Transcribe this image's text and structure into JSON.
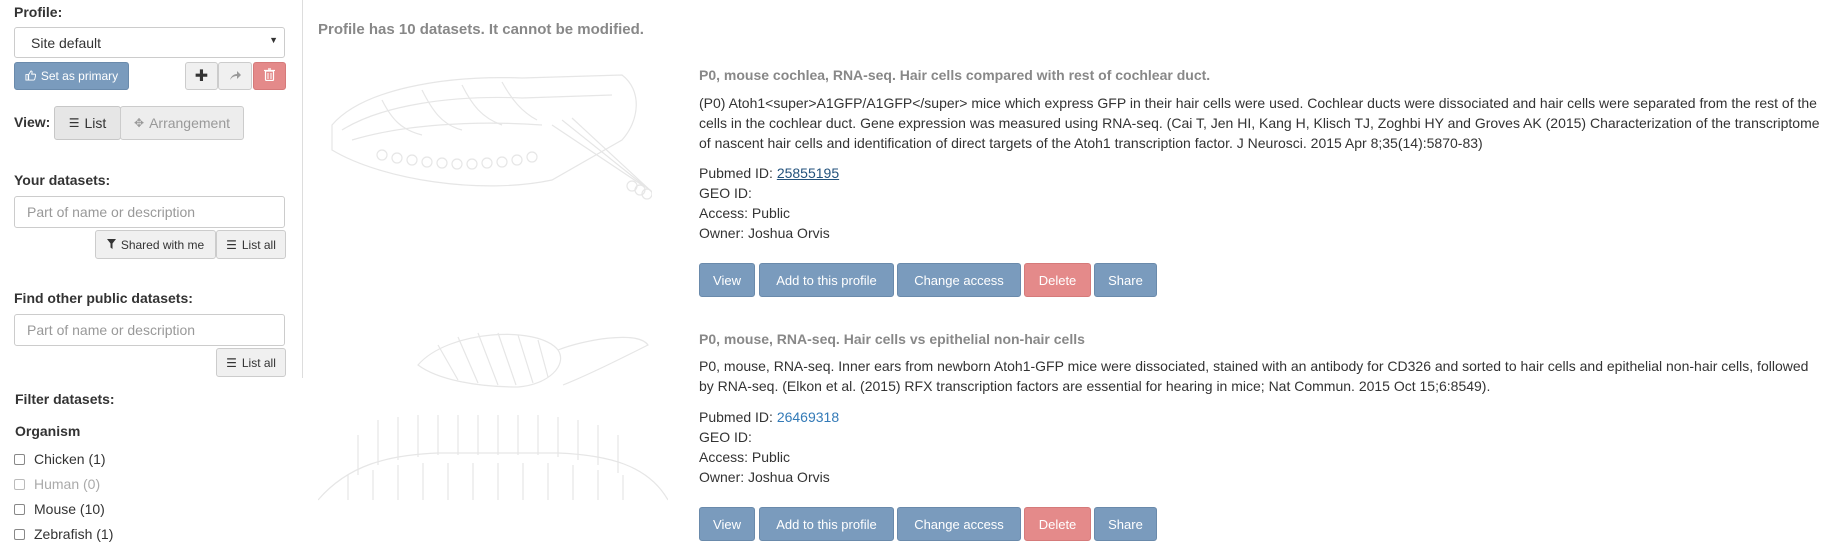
{
  "sidebar": {
    "profile_label": "Profile:",
    "profile_selected": "Site default",
    "set_primary_label": "Set as primary",
    "view_label": "View:",
    "view_list": "List",
    "view_arrangement": "Arrangement",
    "your_datasets_label": "Your datasets:",
    "your_datasets_placeholder": "Part of name or description",
    "shared_with_me": "Shared with me",
    "list_all": "List all",
    "find_public_label": "Find other public datasets:",
    "find_public_placeholder": "Part of name or description",
    "filter_label": "Filter datasets:",
    "organism_label": "Organism",
    "organisms": [
      {
        "label": "Chicken (1)",
        "enabled": true
      },
      {
        "label": "Human (0)",
        "enabled": false
      },
      {
        "label": "Mouse (10)",
        "enabled": true
      },
      {
        "label": "Zebrafish (1)",
        "enabled": true
      }
    ]
  },
  "main": {
    "message": "Profile has 10 datasets. It cannot be modified.",
    "datasets": [
      {
        "title": "P0, mouse cochlea, RNA-seq. Hair cells compared with rest of cochlear duct.",
        "description": "(P0) Atoh1<super>A1GFP/A1GFP</super> mice which express GFP in their hair cells were used. Cochlear ducts were dissociated and hair cells were separated from the rest of the cells in the cochlear duct. Gene expression was measured using RNA-seq. (Cai T, Jen HI, Kang H, Klisch TJ, Zoghbi HY and Groves AK (2015) Characterization of the transcriptome of nascent hair cells and identification of direct targets of the Atoh1 transcription factor. J Neurosci. 2015 Apr 8;35(14):5870-83)",
        "pubmed_label": "Pubmed ID:",
        "pubmed_id": "25855195",
        "geo_label": "GEO ID:",
        "access": "Access: Public",
        "owner": "Owner: Joshua Orvis"
      },
      {
        "title": "P0, mouse, RNA-seq. Hair cells vs epithelial non-hair cells",
        "description": "P0, mouse, RNA-seq. Inner ears from newborn Atoh1-GFP mice were dissociated, stained with an antibody for CD326 and sorted to hair cells and epithelial non-hair cells, followed by RNA-seq. (Elkon et al. (2015) RFX transcription factors are essential for hearing in mice; Nat Commun. 2015 Oct 15;6:8549).",
        "pubmed_label": "Pubmed ID:",
        "pubmed_id": "26469318",
        "geo_label": "GEO ID:",
        "access": "Access: Public",
        "owner": "Owner: Joshua Orvis"
      }
    ],
    "actions": {
      "view": "View",
      "add": "Add to this profile",
      "change_access": "Change access",
      "delete": "Delete",
      "share": "Share"
    }
  },
  "colors": {
    "primary_dim": "#7a9bbd",
    "danger_dim": "#e48a8a",
    "link": "#337ab7"
  }
}
